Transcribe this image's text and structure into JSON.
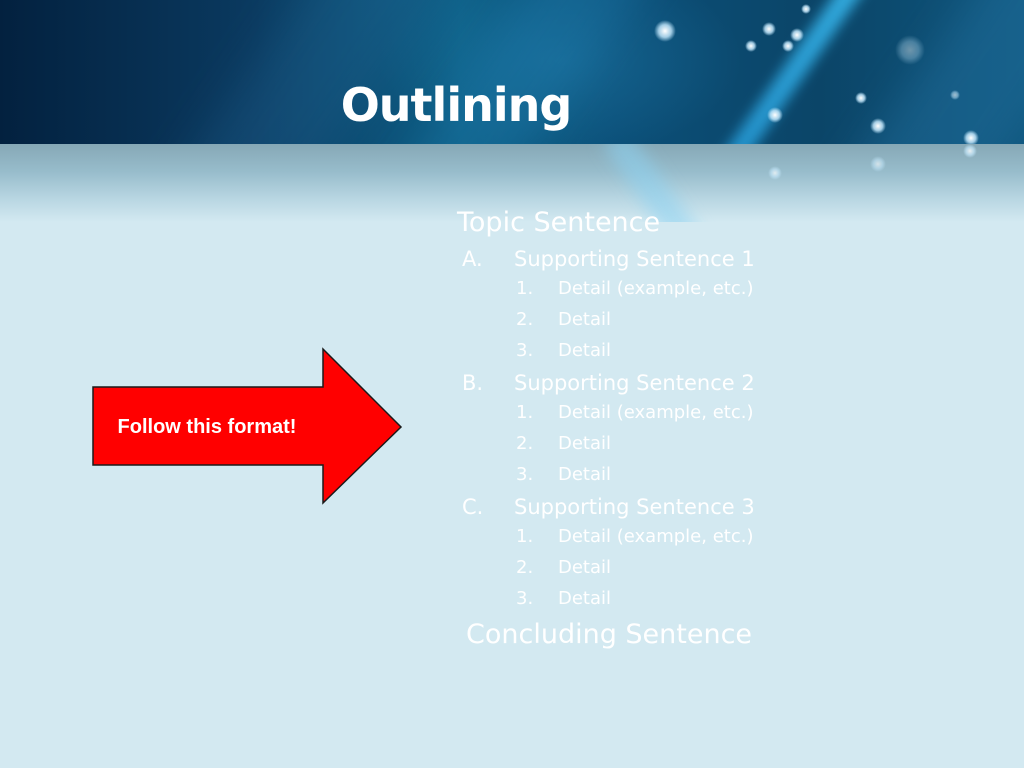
{
  "slide": {
    "title": "Outlining",
    "colors": {
      "background": "#d3e9f1",
      "banner_dark": "#03213f",
      "banner_mid": "#0d5f86",
      "text": "#ffffff",
      "arrow_fill": "#ff0000",
      "arrow_stroke": "#1a1a1a"
    }
  },
  "callout": {
    "shape": "right-arrow",
    "label": "Follow this format!"
  },
  "outline": {
    "topic": "Topic Sentence",
    "sections": [
      {
        "marker": "A.",
        "label": "Supporting Sentence 1",
        "details": [
          {
            "marker": "1.",
            "label": "Detail (example, etc.)"
          },
          {
            "marker": "2.",
            "label": "Detail"
          },
          {
            "marker": "3.",
            "label": "Detail"
          }
        ]
      },
      {
        "marker": "B.",
        "label": "Supporting Sentence 2",
        "details": [
          {
            "marker": "1.",
            "label": "Detail (example, etc.)"
          },
          {
            "marker": "2.",
            "label": "Detail"
          },
          {
            "marker": "3.",
            "label": "Detail"
          }
        ]
      },
      {
        "marker": "C.",
        "label": "Supporting Sentence 3",
        "details": [
          {
            "marker": "1.",
            "label": "Detail (example, etc.)"
          },
          {
            "marker": "2.",
            "label": "Detail"
          },
          {
            "marker": "3.",
            "label": "Detail"
          }
        ]
      }
    ],
    "conclusion": "Concluding Sentence"
  }
}
